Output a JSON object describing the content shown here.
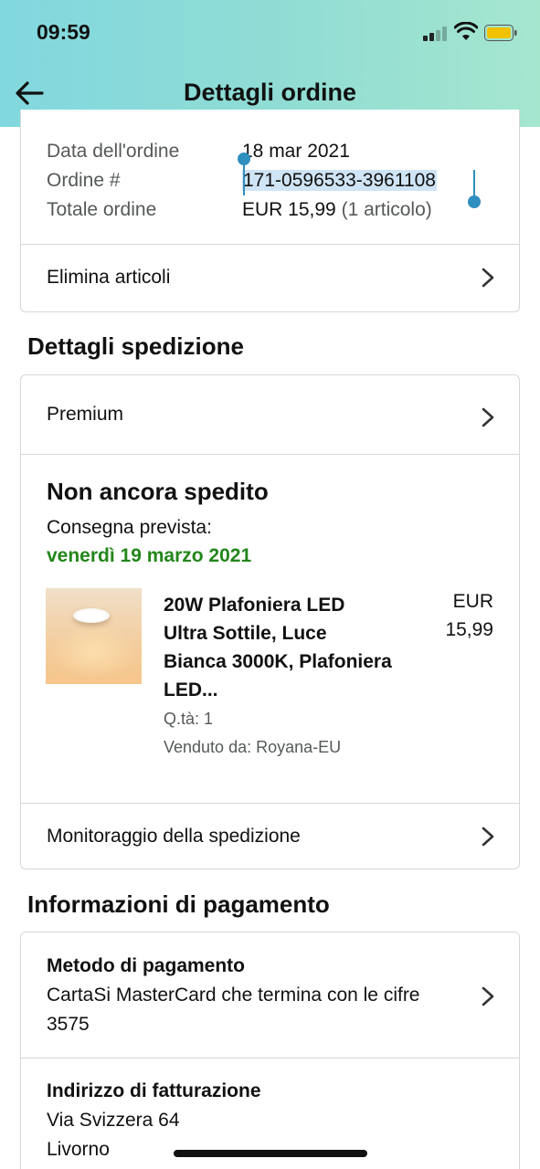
{
  "status_bar": {
    "time": "09:59",
    "battery_color": "#f2c100"
  },
  "header": {
    "title": "Dettagli ordine",
    "back_icon": "back-arrow-icon"
  },
  "order_summary": {
    "date_label": "Data dell'ordine",
    "date_value": "18 mar 2021",
    "order_label": "Ordine #",
    "order_value": "171-0596533-3961108",
    "total_label": "Totale ordine",
    "total_value": "EUR 15,99",
    "total_items": "(1 articolo)",
    "delete_items_label": "Elimina articoli"
  },
  "shipping": {
    "section_title": "Dettagli spedizione",
    "shipping_speed": "Premium",
    "status": "Non ancora spedito",
    "delivery_label": "Consegna prevista:",
    "delivery_date": "venerdì 19 marzo 2021",
    "delivery_date_color": "#23861b",
    "product": {
      "title": "20W Plafoniera LED Ultra Sottile, Luce Bianca 3000K, Plafoniera LED...",
      "currency": "EUR",
      "price": "15,99",
      "quantity": "Q.tà: 1",
      "seller": "Venduto da: Royana-EU"
    },
    "tracking_label": "Monitoraggio della spedizione"
  },
  "payment": {
    "section_title": "Informazioni di pagamento",
    "method_label": "Metodo di pagamento",
    "method_value": "CartaSi MasterCard che termina con le cifre 3575",
    "billing_label": "Indirizzo di fatturazione",
    "billing_line1": "Via Svizzera 64",
    "billing_line2": "Livorno"
  },
  "colors": {
    "selection_handle": "#2f8fbf",
    "selection_highlight": "#cfe4f5",
    "header_gradient_start": "#82d8df",
    "header_gradient_end": "#a5e6cf"
  }
}
